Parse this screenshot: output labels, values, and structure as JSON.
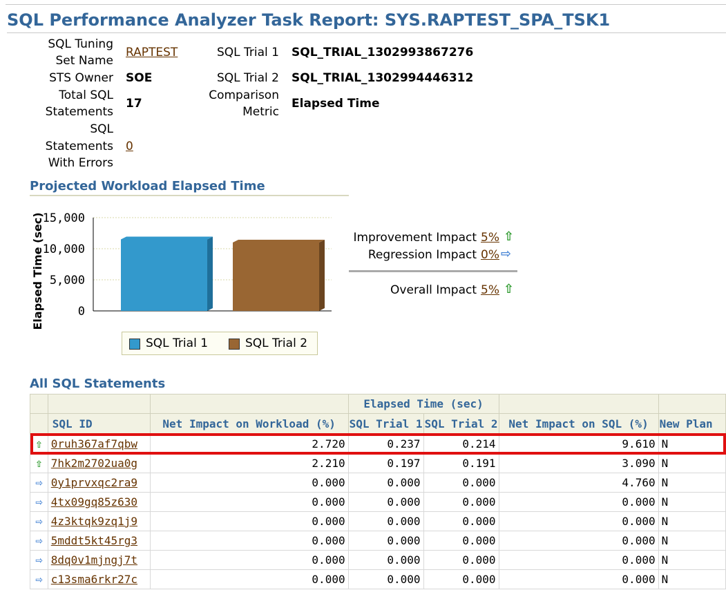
{
  "title": "SQL Performance Analyzer Task Report: SYS.RAPTEST_SPA_TSK1",
  "summary": {
    "sts_name_label_1": "SQL Tuning",
    "sts_name_label_2": "Set Name",
    "sts_name_value": "RAPTEST",
    "sts_owner_label": "STS Owner",
    "sts_owner_value": "SOE",
    "total_sql_label_1": "Total SQL",
    "total_sql_label_2": "Statements",
    "total_sql_value": "17",
    "errors_label_1": "SQL",
    "errors_label_2": "Statements",
    "errors_label_3": "With Errors",
    "errors_value": "0",
    "trial1_label": "SQL Trial 1",
    "trial1_value": "SQL_TRIAL_1302993867276",
    "trial2_label": "SQL Trial 2",
    "trial2_value": "SQL_TRIAL_1302994446312",
    "metric_label_1": "Comparison",
    "metric_label_2": "Metric",
    "metric_value": "Elapsed Time"
  },
  "workload_section_title": "Projected Workload Elapsed Time",
  "chart_data": {
    "type": "bar",
    "categories": [
      "SQL Trial 1",
      "SQL Trial 2"
    ],
    "values": [
      11500,
      11000
    ],
    "ylabel": "Elapsed Time (sec)",
    "yticks": [
      "15,000",
      "10,000",
      "5,000",
      "0"
    ],
    "ylim": [
      0,
      15000
    ],
    "grid": true,
    "colors": [
      "#3399cc",
      "#996633"
    ],
    "legend": [
      "SQL Trial 1",
      "SQL Trial 2"
    ],
    "legend_position": "bottom"
  },
  "impacts": [
    {
      "label": "Improvement Impact",
      "value": "5%",
      "arrow": "up",
      "color": "#2e9a2e"
    },
    {
      "label": "Regression Impact",
      "value": "0%",
      "arrow": "right",
      "color": "#4a87d6"
    },
    {
      "label": "Overall Impact",
      "value": "5%",
      "arrow": "up",
      "color": "#2e9a2e"
    }
  ],
  "sql_section_title": "All SQL Statements",
  "table": {
    "group_header": "Elapsed Time (sec)",
    "columns": [
      "SQL ID",
      "Net Impact on Workload (%)",
      "SQL Trial 1",
      "SQL Trial 2",
      "Net Impact on SQL (%)",
      "New Plan"
    ],
    "rows": [
      {
        "arrow": "up",
        "sql_id": "0ruh367af7qbw",
        "net_workload": "2.720",
        "trial1": "0.237",
        "trial2": "0.214",
        "net_sql": "9.610",
        "new_plan": "N"
      },
      {
        "arrow": "up",
        "sql_id": "7hk2m2702ua0g",
        "net_workload": "2.210",
        "trial1": "0.197",
        "trial2": "0.191",
        "net_sql": "3.090",
        "new_plan": "N"
      },
      {
        "arrow": "right",
        "sql_id": "0y1prvxqc2ra9",
        "net_workload": "0.000",
        "trial1": "0.000",
        "trial2": "0.000",
        "net_sql": "4.760",
        "new_plan": "N"
      },
      {
        "arrow": "right",
        "sql_id": "4tx09gq85z630",
        "net_workload": "0.000",
        "trial1": "0.000",
        "trial2": "0.000",
        "net_sql": "0.000",
        "new_plan": "N"
      },
      {
        "arrow": "right",
        "sql_id": "4z3ktqk9zq1j9",
        "net_workload": "0.000",
        "trial1": "0.000",
        "trial2": "0.000",
        "net_sql": "0.000",
        "new_plan": "N"
      },
      {
        "arrow": "right",
        "sql_id": "5mddt5kt45rg3",
        "net_workload": "0.000",
        "trial1": "0.000",
        "trial2": "0.000",
        "net_sql": "0.000",
        "new_plan": "N"
      },
      {
        "arrow": "right",
        "sql_id": "8dq0v1mjngj7t",
        "net_workload": "0.000",
        "trial1": "0.000",
        "trial2": "0.000",
        "net_sql": "0.000",
        "new_plan": "N"
      },
      {
        "arrow": "right",
        "sql_id": "c13sma6rkr27c",
        "net_workload": "0.000",
        "trial1": "0.000",
        "trial2": "0.000",
        "net_sql": "0.000",
        "new_plan": "N"
      }
    ]
  }
}
